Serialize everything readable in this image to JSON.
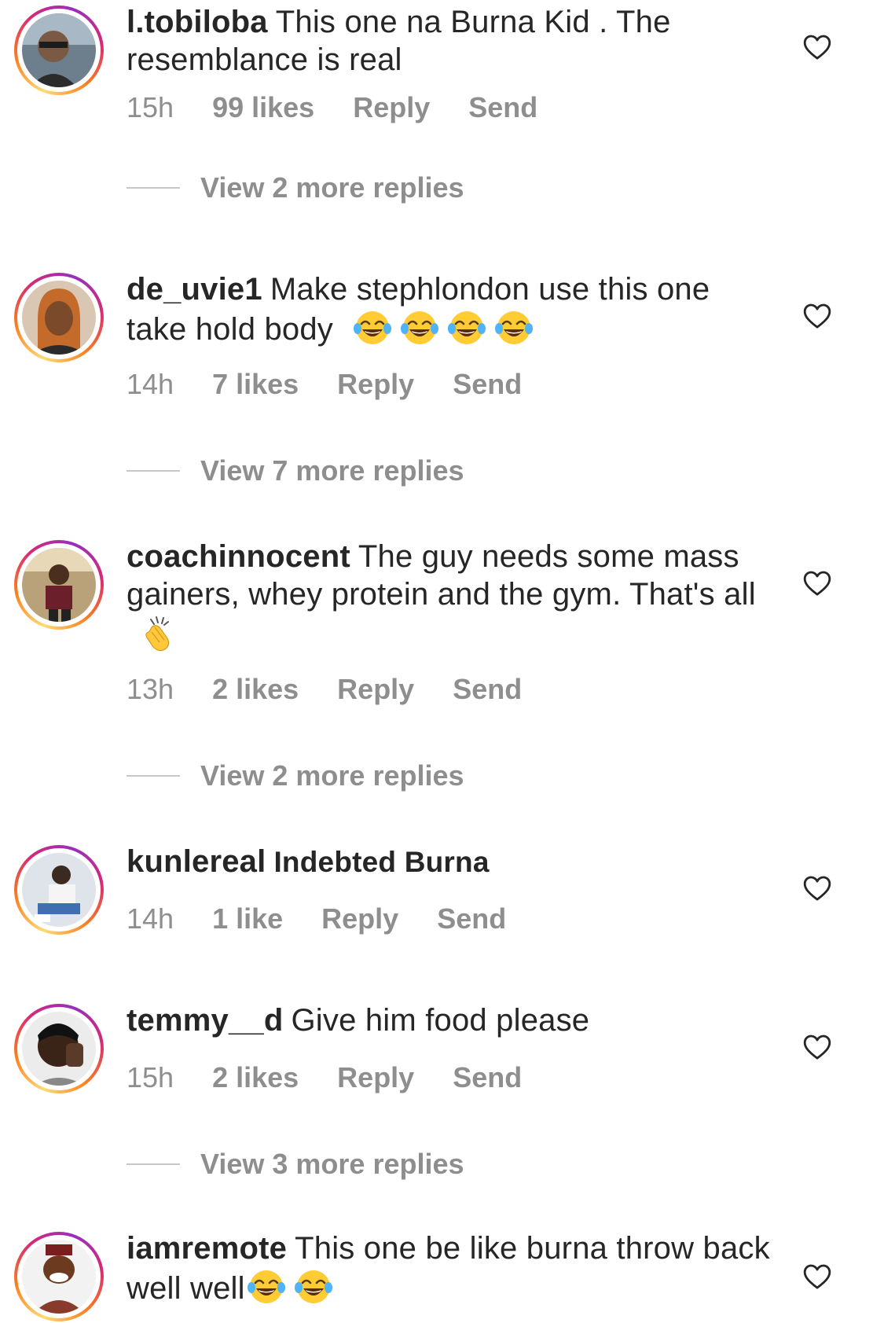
{
  "comments": [
    {
      "username": "l.tobiloba",
      "text": "This one na Burna Kid . The resemblance is real",
      "time": "15h",
      "likes": "99 likes",
      "reply": "Reply",
      "send": "Send",
      "view_replies": "View 2 more replies"
    },
    {
      "username": "de_uvie1",
      "text": "Make stephlondon use this one take hold body",
      "emoji_count": 4,
      "emoji": "face-with-tears-of-joy",
      "time": "14h",
      "likes": "7 likes",
      "reply": "Reply",
      "send": "Send",
      "view_replies": "View 7 more replies"
    },
    {
      "username": "coachinnocent",
      "text": "The guy needs some mass gainers, whey protein and the gym. That's all",
      "emoji": "clapping-hands",
      "time": "13h",
      "likes": "2 likes",
      "reply": "Reply",
      "send": "Send",
      "view_replies": "View 2 more replies"
    },
    {
      "username": "kunlereal",
      "text": "Indebted Burna",
      "time": "14h",
      "likes": "1 like",
      "reply": "Reply",
      "send": "Send"
    },
    {
      "username": "temmy__d",
      "text": "Give him food please",
      "time": "15h",
      "likes": "2 likes",
      "reply": "Reply",
      "send": "Send",
      "view_replies": "View 3 more replies"
    },
    {
      "username": "iamremote",
      "text": "This one be like burna throw back well well",
      "emoji_count": 2,
      "emoji": "face-with-tears-of-joy"
    }
  ],
  "colors": {
    "text": "#262626",
    "meta": "#8e8e8e",
    "story_ring": [
      "#feda75",
      "#fa7e1e",
      "#d62976",
      "#962fbf"
    ]
  },
  "icons": {
    "like": "heart-outline-icon"
  }
}
